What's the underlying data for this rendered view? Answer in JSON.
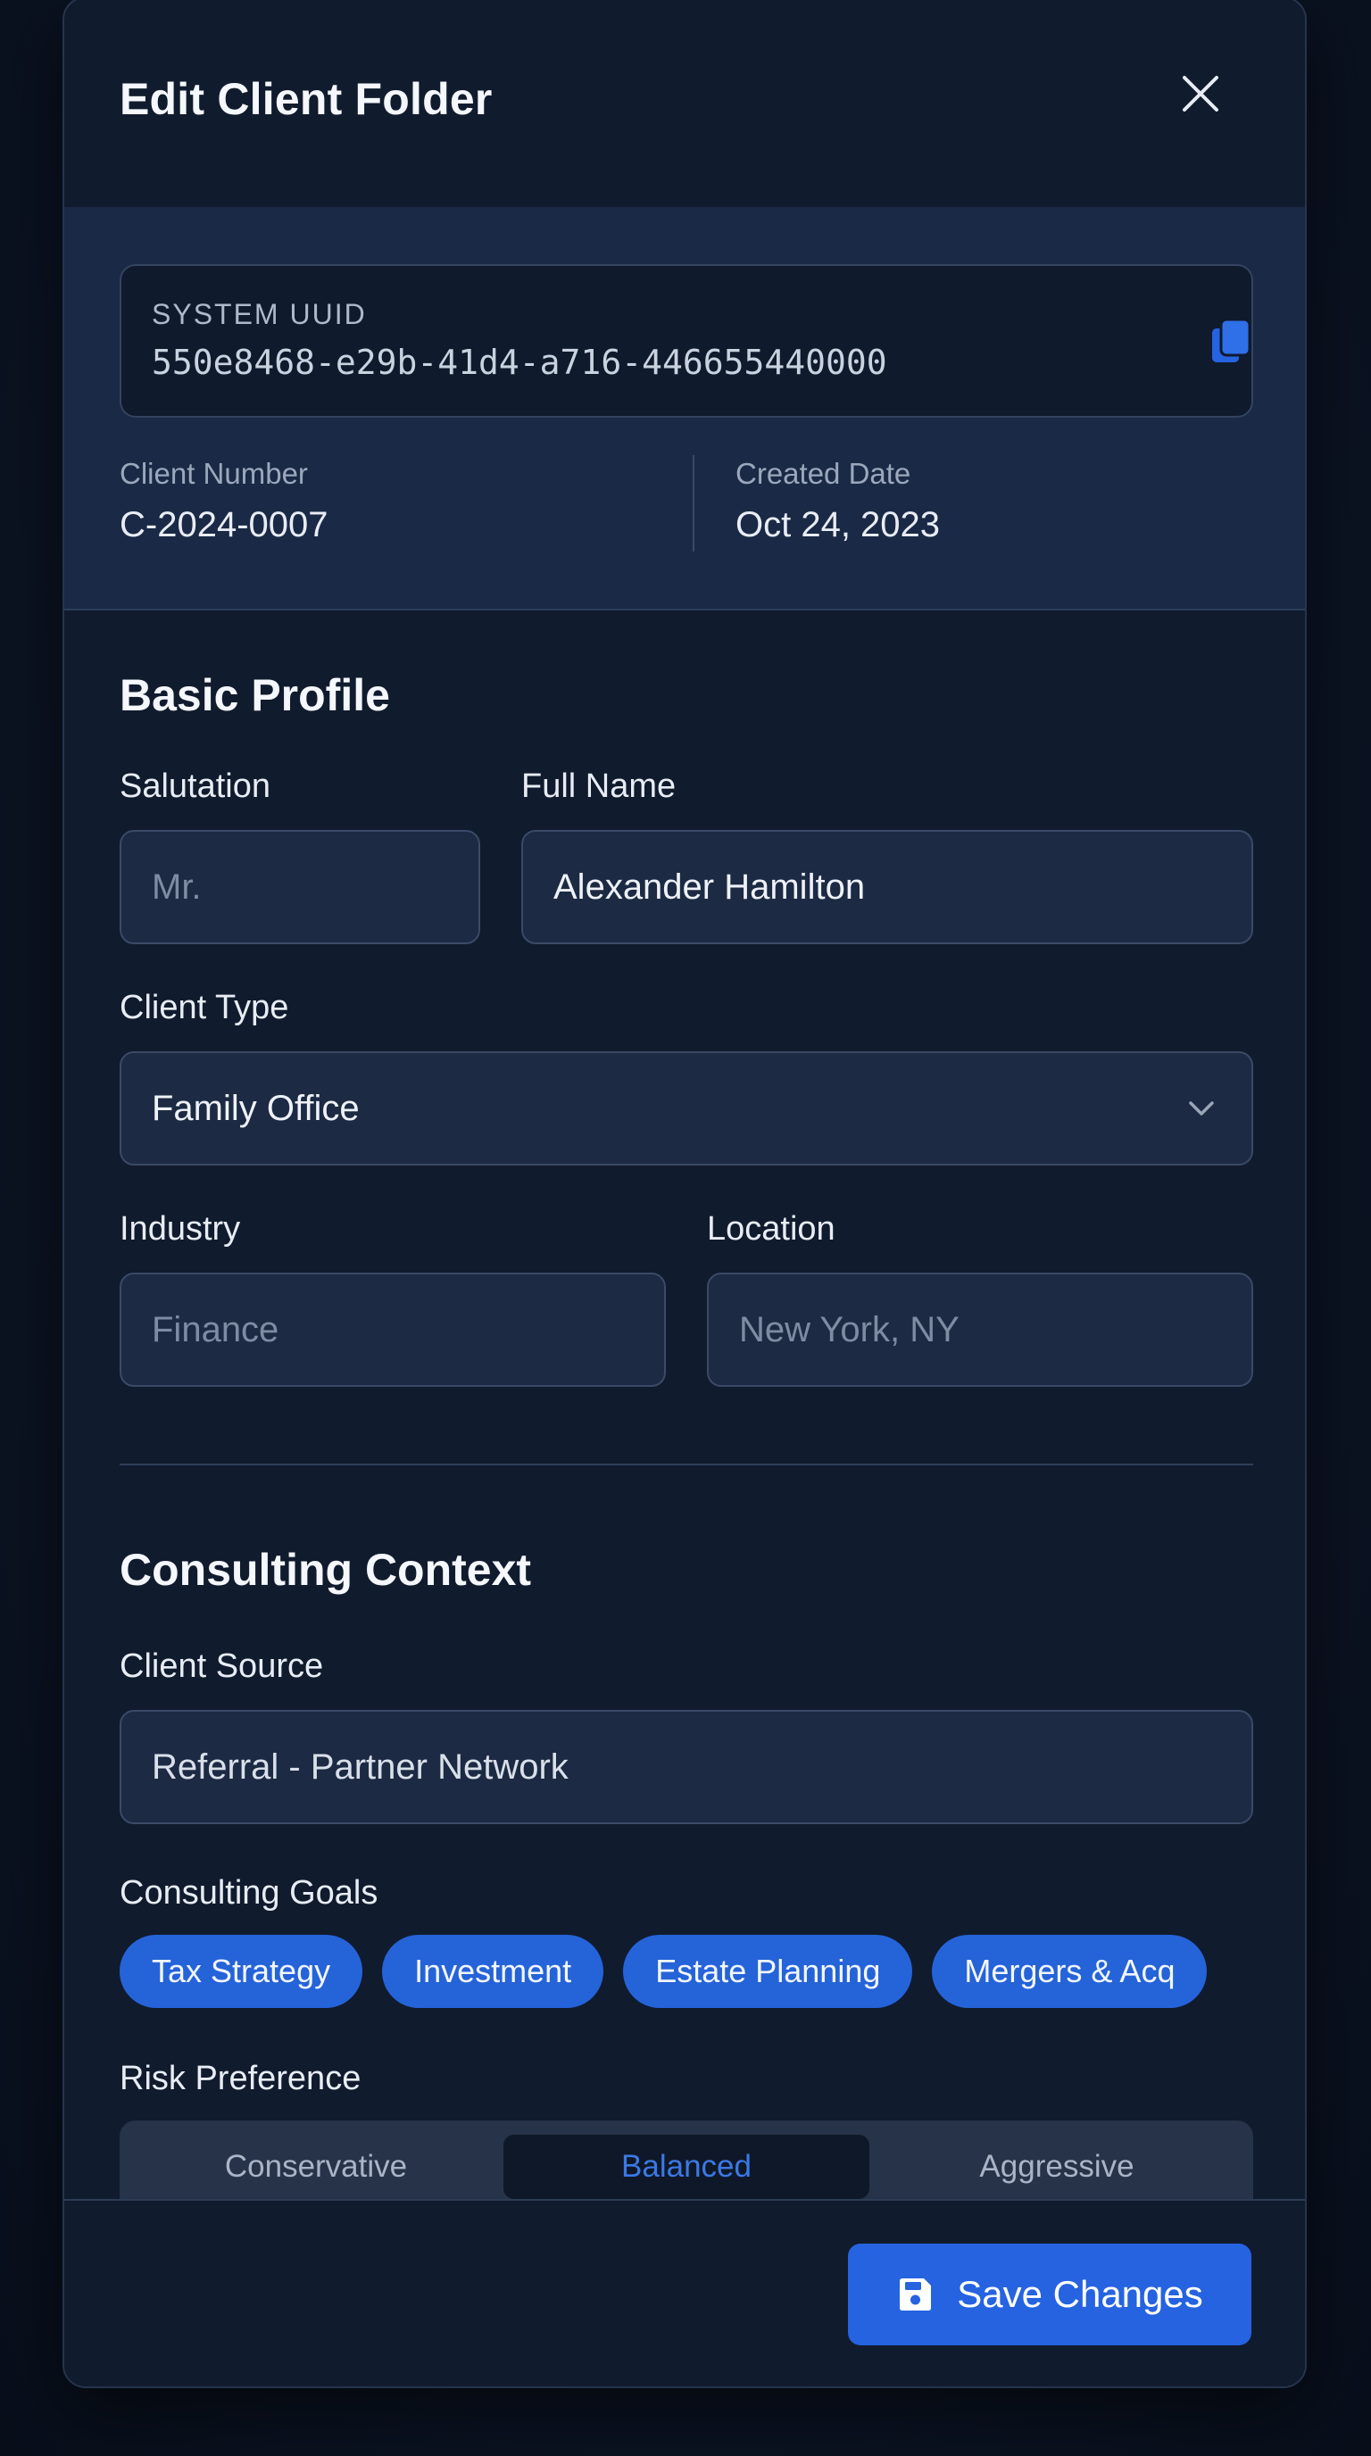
{
  "modal": {
    "title": "Edit Client Folder"
  },
  "meta": {
    "uuid_label": "SYSTEM UUID",
    "uuid_value": "550e8468-e29b-41d4-a716-446655440000",
    "client_number_label": "Client Number",
    "client_number_value": "C-2024-0007",
    "created_date_label": "Created Date",
    "created_date_value": "Oct 24, 2023"
  },
  "basic_profile": {
    "title": "Basic Profile",
    "salutation_label": "Salutation",
    "salutation_placeholder": "Mr.",
    "full_name_label": "Full Name",
    "full_name_value": "Alexander Hamilton",
    "client_type_label": "Client Type",
    "client_type_value": "Family Office",
    "industry_label": "Industry",
    "industry_placeholder": "Finance",
    "location_label": "Location",
    "location_placeholder": "New York, NY"
  },
  "consulting": {
    "title": "Consulting Context",
    "client_source_label": "Client Source",
    "client_source_value": "Referral - Partner Network",
    "goals_label": "Consulting Goals",
    "goals": [
      "Tax Strategy",
      "Investment",
      "Estate Planning",
      "Mergers & Acq"
    ],
    "risk_label": "Risk Preference",
    "risk_options": [
      "Conservative",
      "Balanced",
      "Aggressive"
    ],
    "risk_selected": "Balanced"
  },
  "footer": {
    "save_label": "Save Changes"
  },
  "colors": {
    "accent": "#2563e0",
    "background": "#0b1322",
    "panel": "#111b2e"
  },
  "icons": {
    "close": "close-icon",
    "copy": "copy-icon",
    "chevron": "chevron-down-icon",
    "save": "floppy-disk-icon"
  }
}
